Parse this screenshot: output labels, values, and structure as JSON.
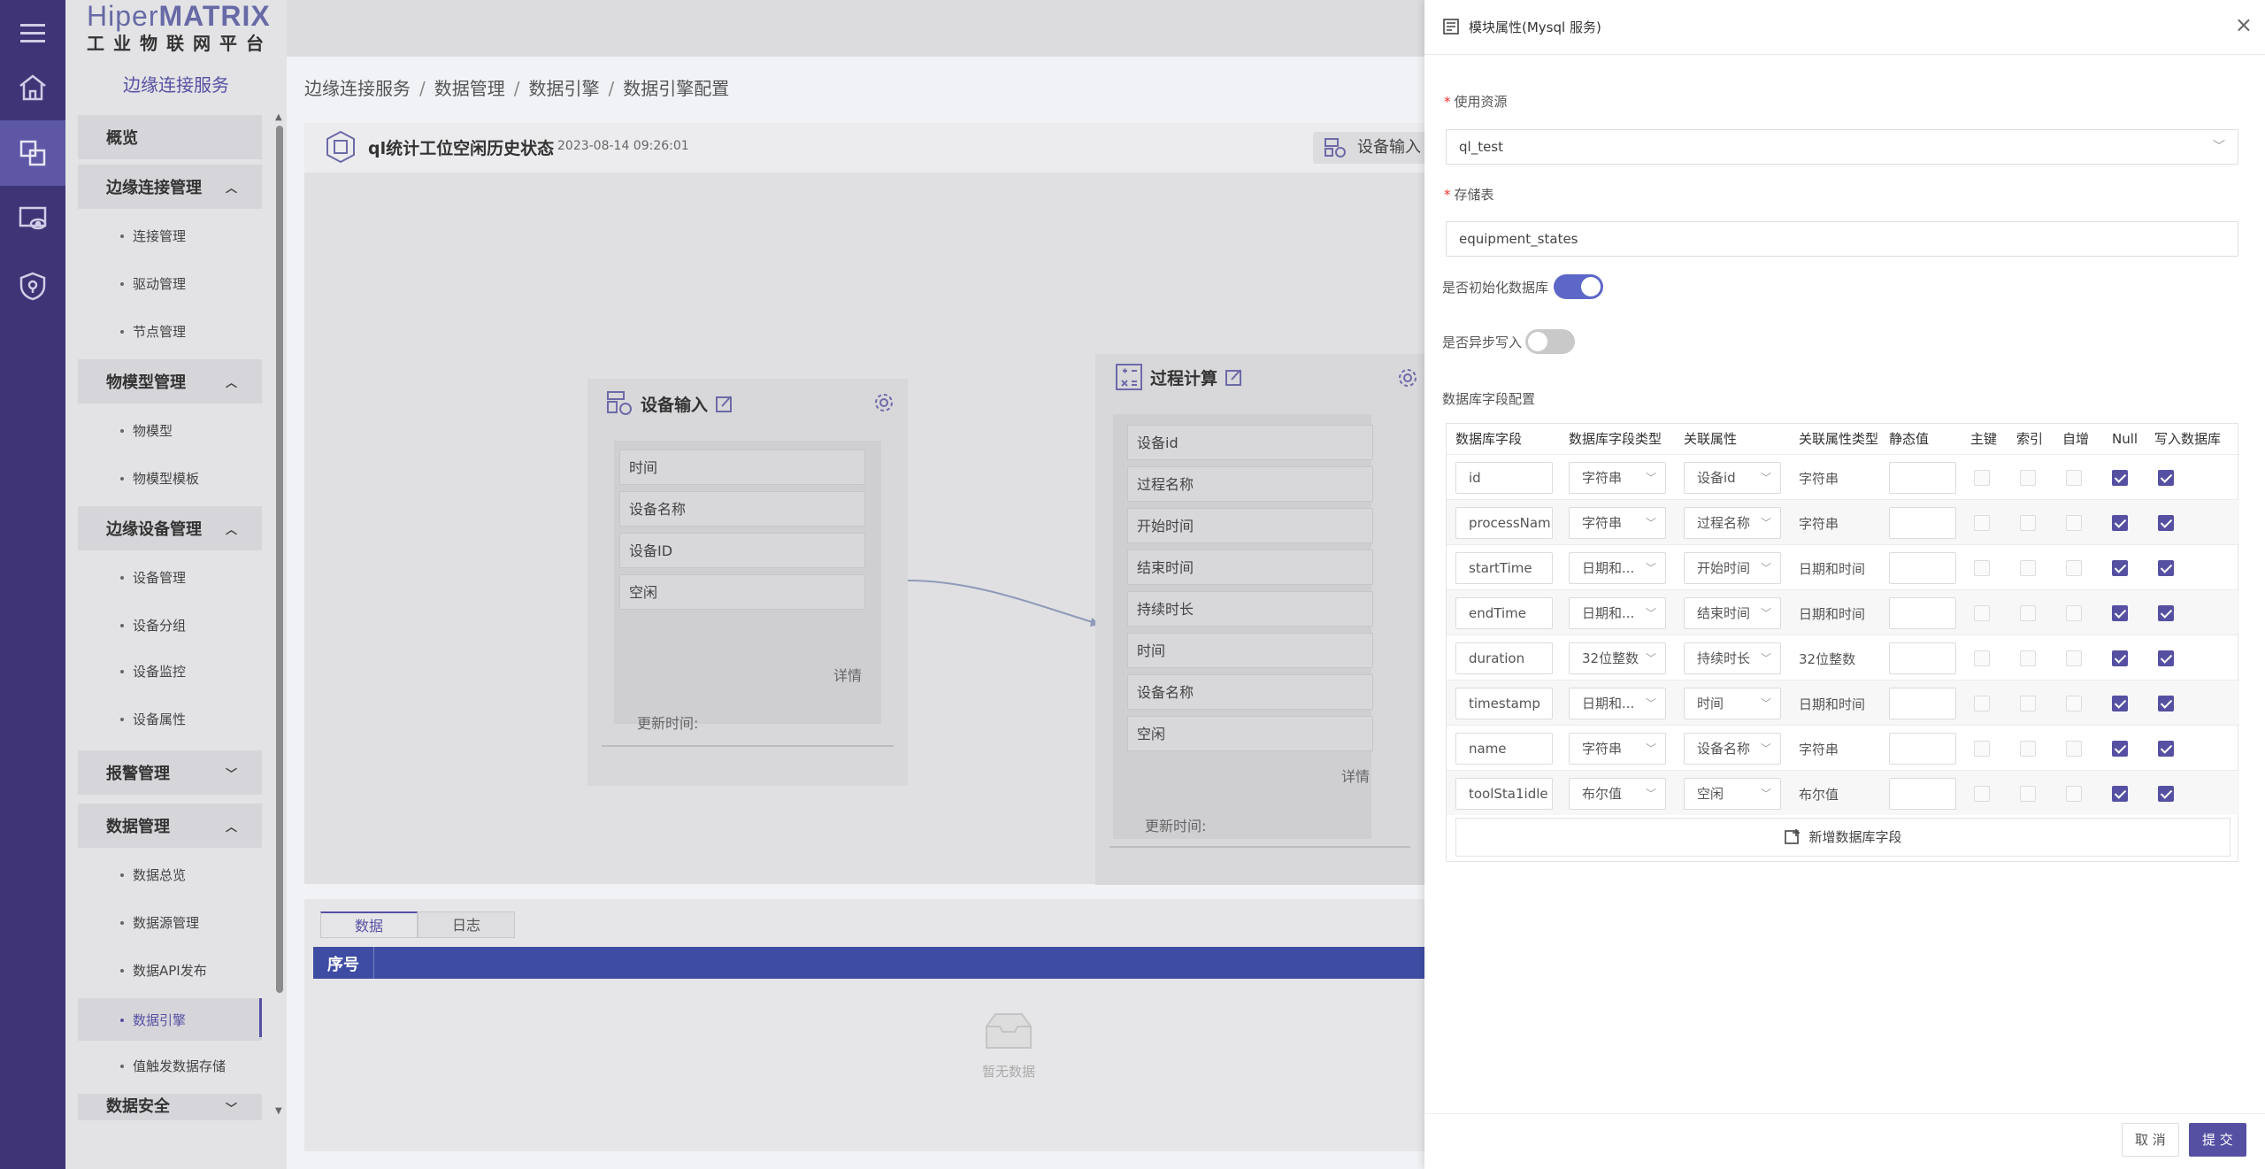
{
  "logo": {
    "line1_a": "Hiper",
    "line1_b": "MATRIX",
    "line2": "工业物联网平台"
  },
  "sidebar": {
    "title": "边缘连接服务",
    "groups": [
      {
        "label": "概览"
      },
      {
        "label": "边缘连接管理",
        "items": [
          "连接管理",
          "驱动管理",
          "节点管理"
        ]
      },
      {
        "label": "物模型管理",
        "items": [
          "物模型",
          "物模型模板"
        ]
      },
      {
        "label": "边缘设备管理",
        "items": [
          "设备管理",
          "设备分组",
          "设备监控",
          "设备属性"
        ]
      },
      {
        "label": "报警管理"
      },
      {
        "label": "数据管理",
        "items": [
          "数据总览",
          "数据源管理",
          "数据API发布",
          "数据引擎",
          "值触发数据存储"
        ]
      },
      {
        "label": "数据安全"
      }
    ],
    "active_item": "数据引擎"
  },
  "breadcrumb": [
    "边缘连接服务",
    "数据管理",
    "数据引擎",
    "数据引擎配置"
  ],
  "flow": {
    "title": "ql统计工位空闲历史状态",
    "timestamp": "2023-08-14 09:26:01",
    "header_button": "设备输入",
    "node_input": {
      "title": "设备输入",
      "fields": [
        "时间",
        "设备名称",
        "设备ID",
        "空闲"
      ],
      "detail": "详情",
      "update": "更新时间:"
    },
    "node_calc": {
      "title": "过程计算",
      "fields": [
        "设备id",
        "过程名称",
        "开始时间",
        "结束时间",
        "持续时长",
        "时间",
        "设备名称",
        "空闲"
      ],
      "detail": "详情",
      "update": "更新时间:"
    }
  },
  "bottom": {
    "tabs": [
      "数据",
      "日志"
    ],
    "active_tab": "数据",
    "col_header": "序号",
    "empty_text": "暂无数据"
  },
  "drawer": {
    "title": "模块属性(Mysql 服务)",
    "close": "×",
    "resource_label": "使用资源",
    "resource_value": "ql_test",
    "table_label": "存储表",
    "table_value": "equipment_states",
    "init_db_label": "是否初始化数据库",
    "init_db_on": true,
    "async_label": "是否异步写入",
    "async_on": false,
    "fields_label": "数据库字段配置",
    "columns": [
      "数据库字段",
      "数据库字段类型",
      "关联属性",
      "关联属性类型",
      "静态值",
      "主键",
      "索引",
      "自增",
      "Null",
      "写入数据库"
    ],
    "rows": [
      {
        "field": "id",
        "type": "字符串",
        "attr": "设备id",
        "attr_type": "字符串",
        "static": "",
        "pk": false,
        "idx": false,
        "ai": false,
        "null": true,
        "write": true
      },
      {
        "field": "processNam",
        "type": "字符串",
        "attr": "过程名称",
        "attr_type": "字符串",
        "static": "",
        "pk": false,
        "idx": false,
        "ai": false,
        "null": true,
        "write": true
      },
      {
        "field": "startTime",
        "type": "日期和...",
        "attr": "开始时间",
        "attr_type": "日期和时间",
        "static": "",
        "pk": false,
        "idx": false,
        "ai": false,
        "null": true,
        "write": true
      },
      {
        "field": "endTime",
        "type": "日期和...",
        "attr": "结束时间",
        "attr_type": "日期和时间",
        "static": "",
        "pk": false,
        "idx": false,
        "ai": false,
        "null": true,
        "write": true
      },
      {
        "field": "duration",
        "type": "32位整数",
        "attr": "持续时长",
        "attr_type": "32位整数",
        "static": "",
        "pk": false,
        "idx": false,
        "ai": false,
        "null": true,
        "write": true
      },
      {
        "field": "timestamp",
        "type": "日期和...",
        "attr": "时间",
        "attr_type": "日期和时间",
        "static": "",
        "pk": false,
        "idx": false,
        "ai": false,
        "null": true,
        "write": true
      },
      {
        "field": "name",
        "type": "字符串",
        "attr": "设备名称",
        "attr_type": "字符串",
        "static": "",
        "pk": false,
        "idx": false,
        "ai": false,
        "null": true,
        "write": true
      },
      {
        "field": "toolSta1idle",
        "type": "布尔值",
        "attr": "空闲",
        "attr_type": "布尔值",
        "static": "",
        "pk": false,
        "idx": false,
        "ai": false,
        "null": true,
        "write": true
      }
    ],
    "add_field": "新增数据库字段",
    "cancel": "取 消",
    "submit": "提 交"
  },
  "colors": {
    "accent": "#5650a2",
    "rail": "#3f3476",
    "switch_on": "#5d67c8",
    "grid_header": "#3e4ca3"
  }
}
